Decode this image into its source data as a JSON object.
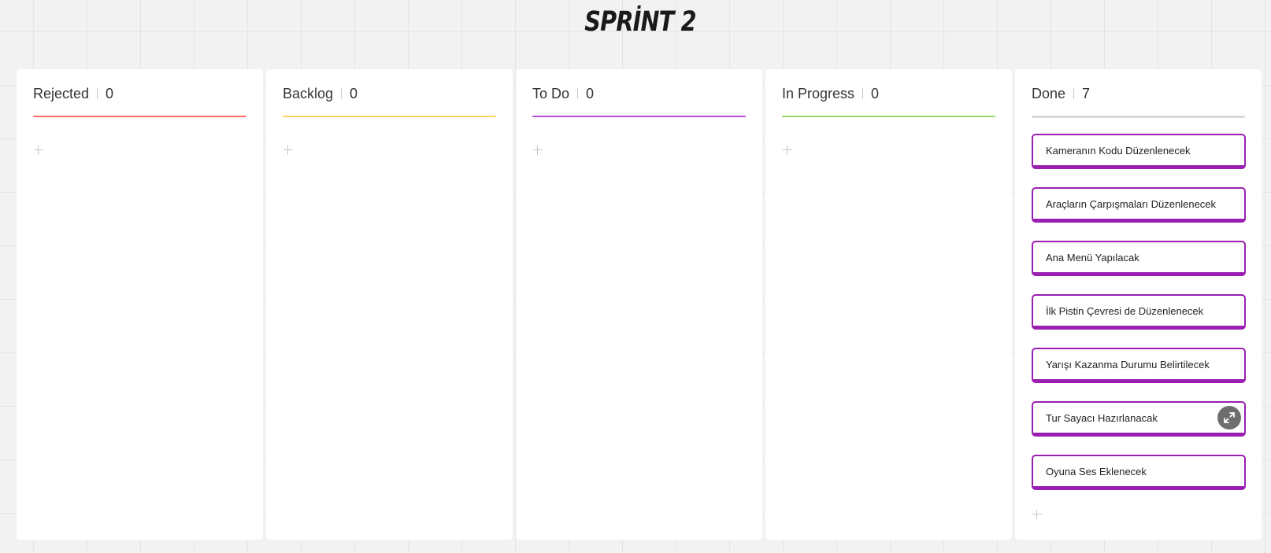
{
  "board": {
    "title": "SPRİNT 2"
  },
  "colors": {
    "rejected": "#ff6f61",
    "backlog": "#ffd45c",
    "todo": "#b44fd6",
    "in_progress": "#98d66c",
    "done": "#d9d9d9",
    "card_border": "#9a1fb0"
  },
  "columns": [
    {
      "title": "Rejected",
      "count": "0"
    },
    {
      "title": "Backlog",
      "count": "0"
    },
    {
      "title": "To Do",
      "count": "0"
    },
    {
      "title": "In Progress",
      "count": "0"
    },
    {
      "title": "Done",
      "count": "7",
      "cards": [
        "Kameranın Kodu Düzenlenecek",
        "Araçların Çarpışmaları Düzenlenecek",
        "Ana Menü Yapılacak",
        "İlk Pistin Çevresi de Düzenlenecek",
        "Yarışı Kazanma Durumu Belirtilecek",
        "Tur Sayacı Hazırlanacak",
        "Oyuna Ses Eklenecek"
      ]
    }
  ]
}
